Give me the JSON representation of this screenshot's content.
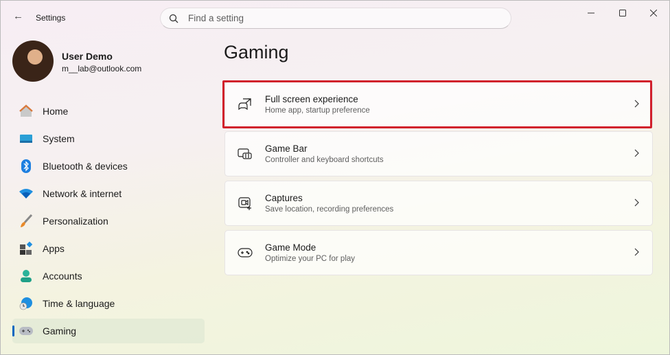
{
  "window": {
    "title": "Settings"
  },
  "search": {
    "placeholder": "Find a setting"
  },
  "user": {
    "name": "User Demo",
    "email": "m__lab@outlook.com"
  },
  "sidebar": {
    "items": [
      {
        "label": "Home",
        "icon": "home-icon"
      },
      {
        "label": "System",
        "icon": "system-icon"
      },
      {
        "label": "Bluetooth & devices",
        "icon": "bluetooth-icon"
      },
      {
        "label": "Network & internet",
        "icon": "wifi-icon"
      },
      {
        "label": "Personalization",
        "icon": "brush-icon"
      },
      {
        "label": "Apps",
        "icon": "apps-icon"
      },
      {
        "label": "Accounts",
        "icon": "account-icon"
      },
      {
        "label": "Time & language",
        "icon": "globe-clock-icon"
      },
      {
        "label": "Gaming",
        "icon": "gamepad-icon",
        "selected": true
      }
    ]
  },
  "main": {
    "title": "Gaming",
    "cards": [
      {
        "title": "Full screen experience",
        "subtitle": "Home app, startup preference",
        "highlighted": true
      },
      {
        "title": "Game Bar",
        "subtitle": "Controller and keyboard shortcuts"
      },
      {
        "title": "Captures",
        "subtitle": "Save location, recording preferences"
      },
      {
        "title": "Game Mode",
        "subtitle": "Optimize your PC for play"
      }
    ]
  },
  "colors": {
    "accent": "#0067c0",
    "highlight": "#d11f2b"
  }
}
